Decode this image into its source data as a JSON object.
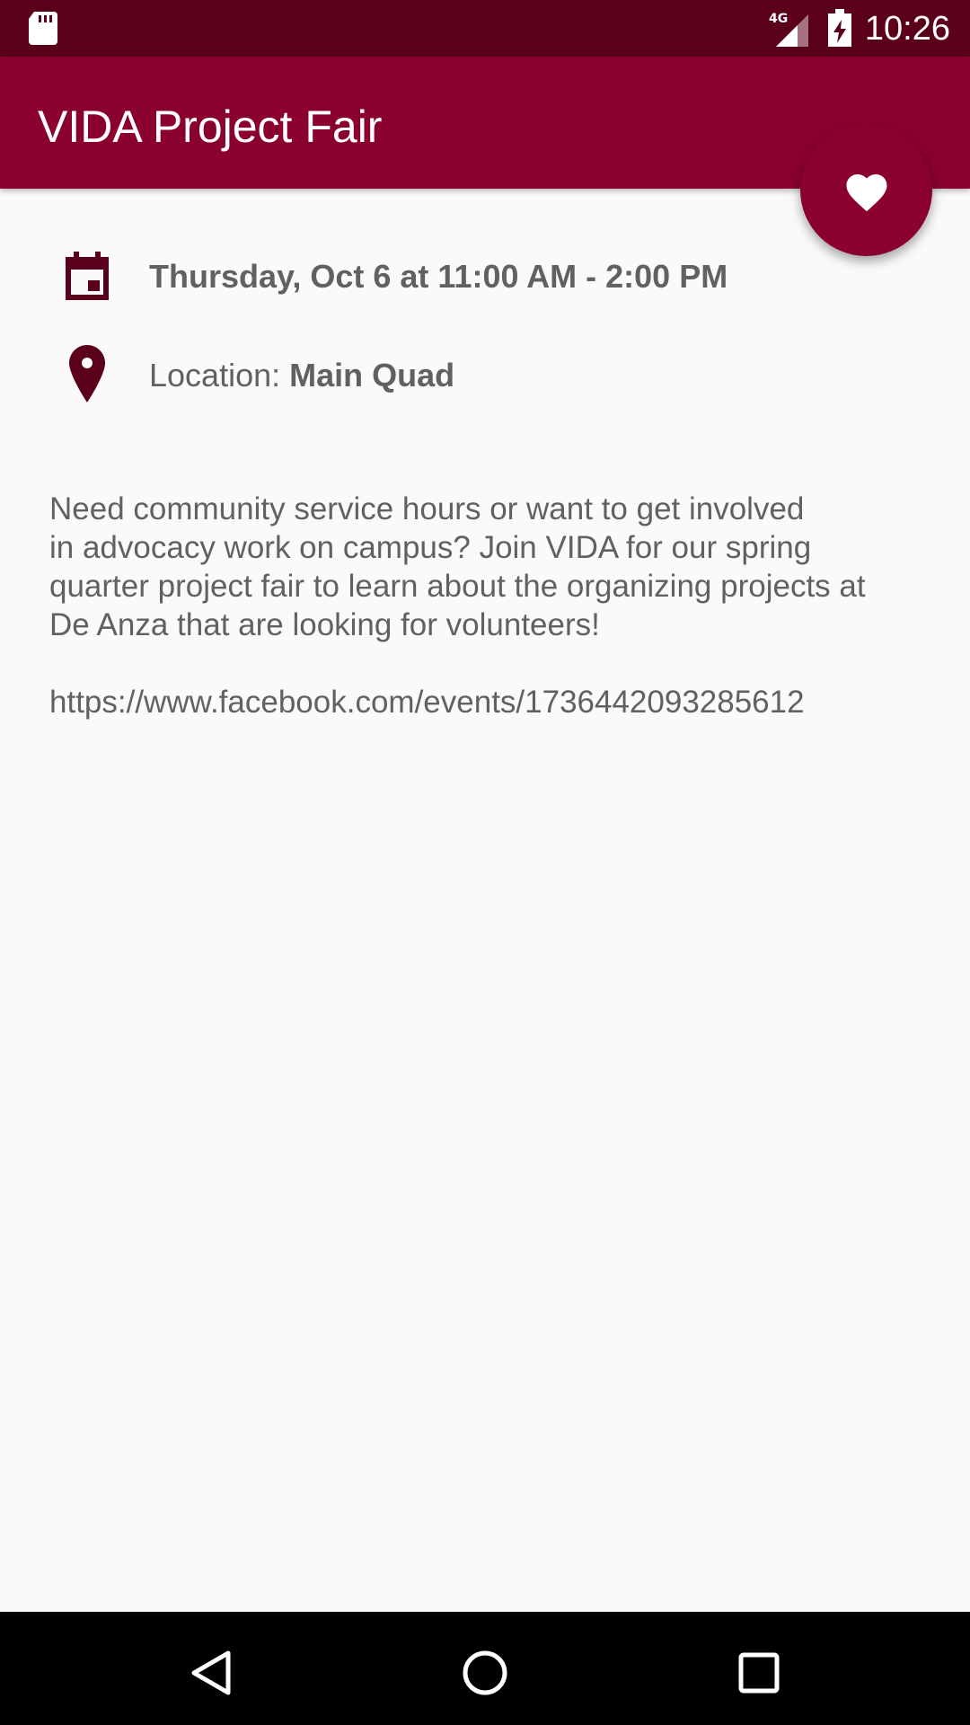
{
  "status_bar": {
    "time": "10:26",
    "network": "4G",
    "icons": [
      "sd-card-icon",
      "signal-icon",
      "battery-charging-icon"
    ]
  },
  "app_bar": {
    "title": "VIDA Project Fair"
  },
  "fab": {
    "icon": "heart-icon"
  },
  "event": {
    "datetime": "Thursday, Oct 6 at 11:00 AM - 2:00 PM",
    "location_label": "Location:",
    "location_value": "Main Quad",
    "description": "Need community service hours or want to get involved\nin advocacy work on campus? Join VIDA for our spring\nquarter project fair to learn about the organizing projects at\nDe Anza that are looking for volunteers!",
    "link": "https://www.facebook.com/events/1736442093285612"
  },
  "nav_bar": {
    "icons": [
      "back-icon",
      "home-icon",
      "recents-icon"
    ]
  },
  "colors": {
    "status_bar": "#5a001b",
    "primary": "#8a002e",
    "icon": "#5a001b",
    "text": "#616161",
    "background": "#fafafa"
  }
}
